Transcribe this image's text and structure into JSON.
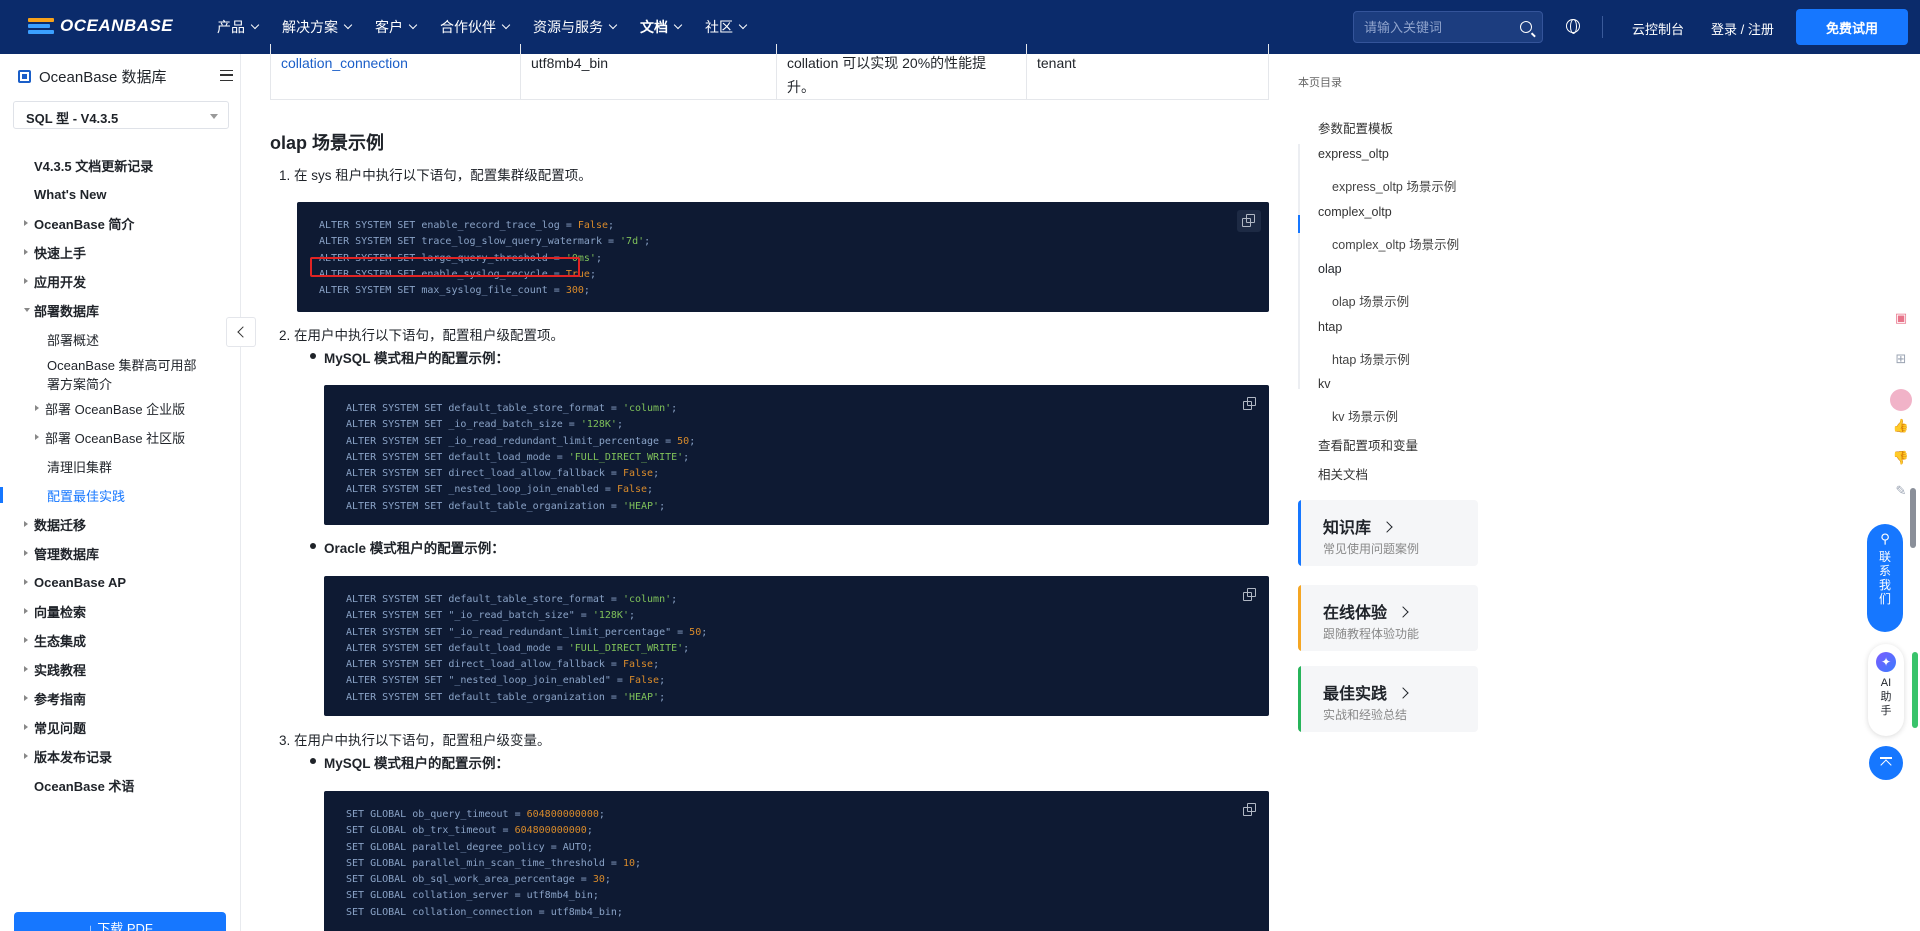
{
  "header": {
    "logo": "OCEANBASE",
    "nav": [
      "产品",
      "解决方案",
      "客户",
      "合作伙伴",
      "资源与服务",
      "文档",
      "社区"
    ],
    "active_nav": "文档",
    "search_placeholder": "请输入关键词",
    "console": "云控制台",
    "login": "登录 / 注册",
    "trial": "免费试用"
  },
  "sidebar": {
    "title": "OceanBase 数据库",
    "version": "SQL 型 - V4.3.5",
    "items": [
      {
        "label": "V4.3.5 文档更新记录"
      },
      {
        "label": "What's New"
      },
      {
        "label": "OceanBase 简介"
      },
      {
        "label": "快速上手"
      },
      {
        "label": "应用开发"
      },
      {
        "label": "部署数据库"
      },
      {
        "label": "部署概述"
      },
      {
        "label": "OceanBase 集群高可用部署方案简介"
      },
      {
        "label": "部署 OceanBase 企业版"
      },
      {
        "label": "部署 OceanBase 社区版"
      },
      {
        "label": "清理旧集群"
      },
      {
        "label": "配置最佳实践"
      },
      {
        "label": "数据迁移"
      },
      {
        "label": "管理数据库"
      },
      {
        "label": "OceanBase AP"
      },
      {
        "label": "向量检索"
      },
      {
        "label": "生态集成"
      },
      {
        "label": "实践教程"
      },
      {
        "label": "参考指南"
      },
      {
        "label": "常见问题"
      },
      {
        "label": "版本发布记录"
      },
      {
        "label": "OceanBase 术语"
      }
    ],
    "download": "↓ 下载 PDF"
  },
  "content": {
    "table_row": [
      "collation_connection",
      "utf8mb4_bin",
      "collation 可以实现 20%的性能提升。",
      "tenant"
    ],
    "heading": "olap 场景示例",
    "step1": "1. 在 sys 租户中执行以下语句，配置集群级配置项。",
    "step2": "2. 在用户中执行以下语句，配置租户级配置项。",
    "step3": "3. 在用户中执行以下语句，配置租户级变量。",
    "mysql_label": "MySQL 模式租户的配置示例：",
    "oracle_label": "Oracle 模式租户的配置示例：",
    "mysql_label2": "MySQL 模式租户的配置示例：",
    "code1": [
      [
        "ALTER SYSTEM SET enable_record_trace_log = ",
        "False",
        ";"
      ],
      [
        "ALTER SYSTEM SET trace_log_slow_query_watermark = ",
        "'7d'",
        ";"
      ],
      [
        "ALTER SYSTEM SET large_query_threshold = ",
        "'0ms'",
        ";"
      ],
      [
        "ALTER SYSTEM SET enable_syslog_recycle = ",
        "True",
        ";"
      ],
      [
        "ALTER SYSTEM SET max_syslog_file_count = ",
        "300",
        ";"
      ]
    ],
    "code2": [
      [
        "ALTER SYSTEM SET default_table_store_format = ",
        "'column'",
        ";"
      ],
      [
        "ALTER SYSTEM SET _io_read_batch_size = ",
        "'128K'",
        ";"
      ],
      [
        "ALTER SYSTEM SET _io_read_redundant_limit_percentage = ",
        "50",
        ";"
      ],
      [
        "ALTER SYSTEM SET default_load_mode = ",
        "'FULL_DIRECT_WRITE'",
        ";"
      ],
      [
        "ALTER SYSTEM SET direct_load_allow_fallback = ",
        "False",
        ";"
      ],
      [
        "ALTER SYSTEM SET _nested_loop_join_enabled = ",
        "False",
        ";"
      ],
      [
        "ALTER SYSTEM SET default_table_organization = ",
        "'HEAP'",
        ";"
      ]
    ],
    "code3": [
      [
        "ALTER SYSTEM SET default_table_store_format = ",
        "'column'",
        ";"
      ],
      [
        "ALTER SYSTEM SET \"_io_read_batch_size\" = ",
        "'128K'",
        ";"
      ],
      [
        "ALTER SYSTEM SET \"_io_read_redundant_limit_percentage\" = ",
        "50",
        ";"
      ],
      [
        "ALTER SYSTEM SET default_load_mode = ",
        "'FULL_DIRECT_WRITE'",
        ";"
      ],
      [
        "ALTER SYSTEM SET direct_load_allow_fallback = ",
        "False",
        ";"
      ],
      [
        "ALTER SYSTEM SET \"_nested_loop_join_enabled\" = ",
        "False",
        ";"
      ],
      [
        "ALTER SYSTEM SET default_table_organization = ",
        "'HEAP'",
        ";"
      ]
    ],
    "code4": [
      [
        "SET GLOBAL ob_query_timeout = ",
        "604800000000",
        ";"
      ],
      [
        "SET GLOBAL ob_trx_timeout = ",
        "604800000000",
        ";"
      ],
      [
        "SET GLOBAL parallel_degree_policy = AUTO;",
        "",
        ""
      ],
      [
        "SET GLOBAL parallel_min_scan_time_threshold = ",
        "10",
        ";"
      ],
      [
        "SET GLOBAL ob_sql_work_area_percentage = ",
        "30",
        ";"
      ],
      [
        "SET GLOBAL collation_server = utf8mb4_bin;",
        "",
        ""
      ],
      [
        "SET GLOBAL collation_connection = utf8mb4_bin;",
        "",
        ""
      ]
    ]
  },
  "toc": {
    "title": "本页目录",
    "items": [
      "参数配置模板",
      "express_oltp",
      "express_oltp 场景示例",
      "complex_oltp",
      "complex_oltp 场景示例",
      "olap",
      "olap 场景示例",
      "htap",
      "htap 场景示例",
      "kv",
      "kv 场景示例",
      "查看配置项和变量",
      "相关文档"
    ]
  },
  "cards": [
    {
      "title": "知识库",
      "sub": "常见使用问题案例",
      "color": "#1677ff"
    },
    {
      "title": "在线体验",
      "sub": "跟随教程体验功能",
      "color": "#f5a623"
    },
    {
      "title": "最佳实践",
      "sub": "实战和经验总结",
      "color": "#27b45a"
    }
  ],
  "float": {
    "contact": "联系我们",
    "ai": "AI助手"
  }
}
